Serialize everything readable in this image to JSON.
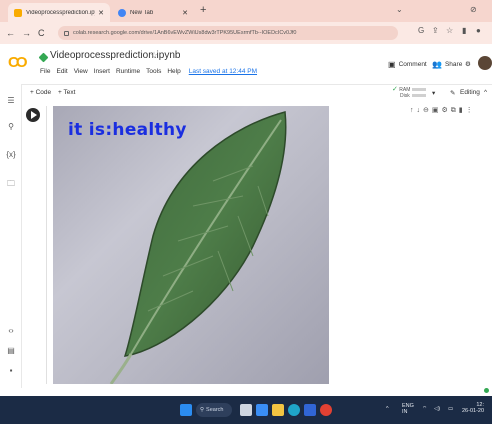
{
  "browser": {
    "tabs": [
      {
        "title": "Videoprocessprediction.ipynb - C",
        "active": true
      },
      {
        "title": "New Tab",
        "active": false
      }
    ],
    "url": "colab.research.google.com/drive/1AnB6vEWvZWiUs8dw3rTPK95UEsrmfTb--IOEDcICv0Jf0"
  },
  "colab": {
    "notebook_title": "Videoprocessprediction.ipynb",
    "menus": [
      "File",
      "Edit",
      "View",
      "Insert",
      "Runtime",
      "Tools",
      "Help"
    ],
    "last_saved": "Last saved at 12:44 PM",
    "comment_label": "Comment",
    "share_label": "Share",
    "add_code": "+ Code",
    "add_text": "+ Text",
    "ram_label": "RAM",
    "disk_label": "Disk",
    "editing_label": "Editing"
  },
  "output": {
    "prediction_text": "it is:healthy"
  },
  "taskbar": {
    "search_label": "Search",
    "lang_top": "ENG",
    "lang_bottom": "IN",
    "time": "12:",
    "date": "26-01-20"
  },
  "colors": {
    "tab_strip": "#f6d6ce",
    "prediction_text": "#1a2ee0",
    "taskbar": "#1b2b45",
    "colab_orange": "#f9ab00"
  }
}
